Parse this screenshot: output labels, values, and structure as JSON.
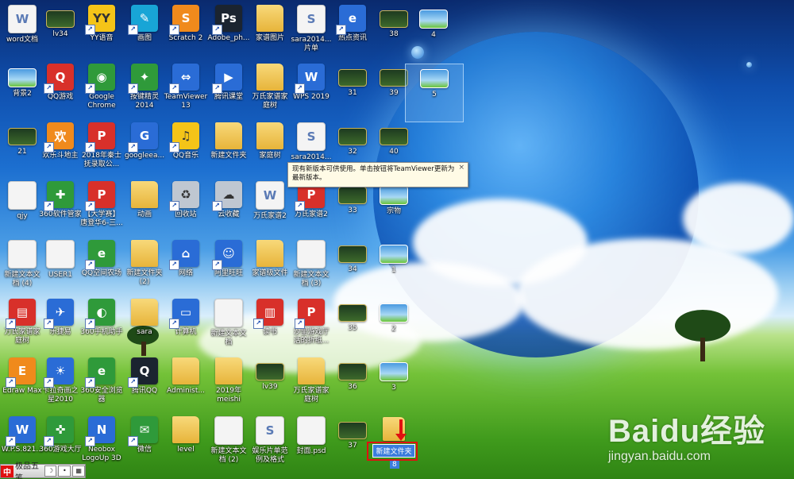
{
  "desktop": {
    "icons": [
      {
        "label": "word文档",
        "type": "doc",
        "glyph": "W"
      },
      {
        "label": "lv34",
        "type": "thumb",
        "glyph": ""
      },
      {
        "label": "YY语音",
        "type": "yellow",
        "glyph": "YY"
      },
      {
        "label": "画图",
        "type": "cyan",
        "glyph": "✎"
      },
      {
        "label": "Scratch 2",
        "type": "orange",
        "glyph": "S"
      },
      {
        "label": "Adobe_ph...",
        "type": "dark",
        "glyph": "Ps"
      },
      {
        "label": "家谱图片",
        "type": "folder",
        "glyph": ""
      },
      {
        "label": "sara2014...\n片单",
        "type": "doc",
        "glyph": "S"
      },
      {
        "label": "热点资讯",
        "type": "blue",
        "glyph": "e"
      },
      {
        "label": "38",
        "type": "thumb",
        "glyph": ""
      },
      {
        "label": "4",
        "type": "sky",
        "glyph": ""
      },
      {
        "label": "背景2",
        "type": "sky",
        "glyph": ""
      },
      {
        "label": "QQ游戏",
        "type": "red",
        "glyph": "Q"
      },
      {
        "label": "Google\nChrome",
        "type": "green",
        "glyph": "◉"
      },
      {
        "label": "按键精灵\n2014",
        "type": "green",
        "glyph": "✦"
      },
      {
        "label": "TeamViewer\n13",
        "type": "blue",
        "glyph": "⇔"
      },
      {
        "label": "腾讯课堂",
        "type": "blue",
        "glyph": "▶"
      },
      {
        "label": "万氏家谱家\n庭树",
        "type": "folder",
        "glyph": ""
      },
      {
        "label": "WPS 2019",
        "type": "blue",
        "glyph": "W"
      },
      {
        "label": "31",
        "type": "thumb",
        "glyph": ""
      },
      {
        "label": "39",
        "type": "thumb",
        "glyph": ""
      },
      {
        "label": "5",
        "type": "sky",
        "glyph": ""
      },
      {
        "label": "21",
        "type": "thumb",
        "glyph": ""
      },
      {
        "label": "欢乐斗地主",
        "type": "orange",
        "glyph": "欢"
      },
      {
        "label": "2018年秦士\n抚录取公...",
        "type": "red",
        "glyph": "P"
      },
      {
        "label": "googleea...",
        "type": "blue",
        "glyph": "G"
      },
      {
        "label": "QQ音乐",
        "type": "yellow",
        "glyph": "♫"
      },
      {
        "label": "新建文件夹",
        "type": "folder",
        "glyph": ""
      },
      {
        "label": "家庭树",
        "type": "folder",
        "glyph": ""
      },
      {
        "label": "sara2014...",
        "type": "doc",
        "glyph": "S"
      },
      {
        "label": "32",
        "type": "thumb",
        "glyph": ""
      },
      {
        "label": "40",
        "type": "thumb",
        "glyph": ""
      },
      {
        "label": "qjy",
        "type": "doc",
        "glyph": ""
      },
      {
        "label": "360软件管家",
        "type": "green",
        "glyph": "✚"
      },
      {
        "label": "【大学赛】\n唐登华6-三...",
        "type": "red",
        "glyph": "P"
      },
      {
        "label": "动画",
        "type": "folder",
        "glyph": ""
      },
      {
        "label": "回收站",
        "type": "gray",
        "glyph": "♻"
      },
      {
        "label": "云收藏",
        "type": "gray",
        "glyph": "☁"
      },
      {
        "label": "万氏家谱2",
        "type": "doc",
        "glyph": "W"
      },
      {
        "label": "万氏家谱2",
        "type": "red",
        "glyph": "P"
      },
      {
        "label": "33",
        "type": "thumb",
        "glyph": ""
      },
      {
        "label": "宗物",
        "type": "sky",
        "glyph": ""
      },
      {
        "label": "新建文本文\n档 (4)",
        "type": "doc",
        "glyph": ""
      },
      {
        "label": "USER1",
        "type": "doc",
        "glyph": ""
      },
      {
        "label": "QQ空间农场",
        "type": "green",
        "glyph": "e"
      },
      {
        "label": "新建文件夹\n(2)",
        "type": "folder",
        "glyph": ""
      },
      {
        "label": "网络",
        "type": "blue",
        "glyph": "⌂"
      },
      {
        "label": "阿里旺旺",
        "type": "blue",
        "glyph": "☺"
      },
      {
        "label": "家谱级文件",
        "type": "folder",
        "glyph": ""
      },
      {
        "label": "新建文本文\n档 (3)",
        "type": "doc",
        "glyph": ""
      },
      {
        "label": "34",
        "type": "thumb",
        "glyph": ""
      },
      {
        "label": "1",
        "type": "sky",
        "glyph": ""
      },
      {
        "label": "万氏家谱家\n庭树",
        "type": "red",
        "glyph": "▤"
      },
      {
        "label": "乐捷易",
        "type": "blue",
        "glyph": "✈"
      },
      {
        "label": "360手机助手",
        "type": "green",
        "glyph": "◐"
      },
      {
        "label": "sara",
        "type": "folder",
        "glyph": ""
      },
      {
        "label": "计算机",
        "type": "blue",
        "glyph": "▭"
      },
      {
        "label": "新建文本文\n档",
        "type": "doc",
        "glyph": ""
      },
      {
        "label": "读书",
        "type": "red",
        "glyph": "▥"
      },
      {
        "label": "沙里游戏厅\n活的折纸...",
        "type": "red",
        "glyph": "P"
      },
      {
        "label": "35",
        "type": "thumb",
        "glyph": ""
      },
      {
        "label": "2",
        "type": "sky",
        "glyph": ""
      },
      {
        "label": "Edraw Max",
        "type": "orange",
        "glyph": "E"
      },
      {
        "label": "卡拉奇画之\n星2010",
        "type": "blue",
        "glyph": "☀"
      },
      {
        "label": "360安全浏览\n器",
        "type": "green",
        "glyph": "e"
      },
      {
        "label": "腾讯QQ",
        "type": "dark",
        "glyph": "Q"
      },
      {
        "label": "Administ...",
        "type": "folder",
        "glyph": ""
      },
      {
        "label": "2019年\nmeishi",
        "type": "folder",
        "glyph": ""
      },
      {
        "label": "lv39",
        "type": "thumb",
        "glyph": ""
      },
      {
        "label": "万氏家谱家\n庭树",
        "type": "folder",
        "glyph": ""
      },
      {
        "label": "36",
        "type": "thumb",
        "glyph": ""
      },
      {
        "label": "3",
        "type": "sky",
        "glyph": ""
      },
      {
        "label": "W.P.S.821...",
        "type": "blue",
        "glyph": "W"
      },
      {
        "label": "360游戏大厅",
        "type": "green",
        "glyph": "✜"
      },
      {
        "label": "Neobox\nLogoUp 3D",
        "type": "blue",
        "glyph": "N"
      },
      {
        "label": "微信",
        "type": "green",
        "glyph": "✉"
      },
      {
        "label": "level",
        "type": "folder",
        "glyph": ""
      },
      {
        "label": "新建文本文\n档 (2)",
        "type": "doc",
        "glyph": ""
      },
      {
        "label": "娱乐片单范\n例及格式",
        "type": "doc",
        "glyph": "S"
      },
      {
        "label": "封面.psd",
        "type": "doc",
        "glyph": ""
      },
      {
        "label": "37",
        "type": "thumb",
        "glyph": ""
      }
    ]
  },
  "new_folder": {
    "edit_text": "新建文件夹",
    "count": "8"
  },
  "tooltip": {
    "text": "现有新版本可供使用。单击按钮将TeamViewer更新为最新版本。",
    "close": "×"
  },
  "ime_bar": {
    "lang": "中",
    "name": "极品五笔",
    "moon": "☽",
    "dot": "•",
    "grid": "▦"
  },
  "watermark": {
    "logo": "Baidu经验",
    "url": "jingyan.baidu.com"
  },
  "colors": {
    "accent": "#e01010",
    "selection": "#3b7ddd"
  }
}
